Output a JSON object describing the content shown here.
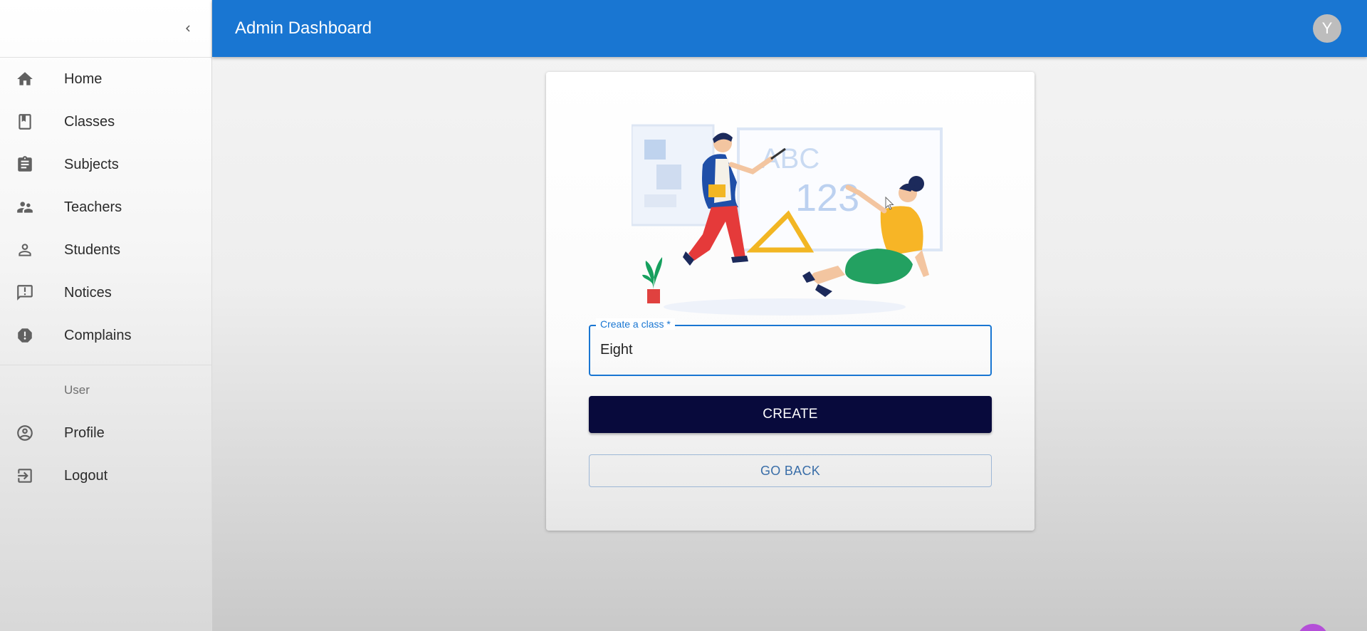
{
  "header": {
    "title": "Admin Dashboard",
    "avatar_initial": "Y"
  },
  "sidebar": {
    "main_items": [
      {
        "label": "Home",
        "icon": "home-icon"
      },
      {
        "label": "Classes",
        "icon": "class-book-icon"
      },
      {
        "label": "Subjects",
        "icon": "clipboard-icon"
      },
      {
        "label": "Teachers",
        "icon": "supervisor-icon"
      },
      {
        "label": "Students",
        "icon": "person-icon"
      },
      {
        "label": "Notices",
        "icon": "announcement-icon"
      },
      {
        "label": "Complains",
        "icon": "alert-icon"
      }
    ],
    "section_label": "User",
    "user_items": [
      {
        "label": "Profile",
        "icon": "account-circle-icon"
      },
      {
        "label": "Logout",
        "icon": "logout-icon"
      }
    ]
  },
  "form": {
    "field_label": "Create a class *",
    "field_value": "Eight",
    "create_label": "CREATE",
    "back_label": "GO BACK"
  },
  "illustration": {
    "board_text_1": "ABC",
    "board_text_2": "123"
  },
  "colors": {
    "appbar": "#1976d2",
    "primary_button": "#080a3c",
    "field_focus": "#1976d2"
  }
}
